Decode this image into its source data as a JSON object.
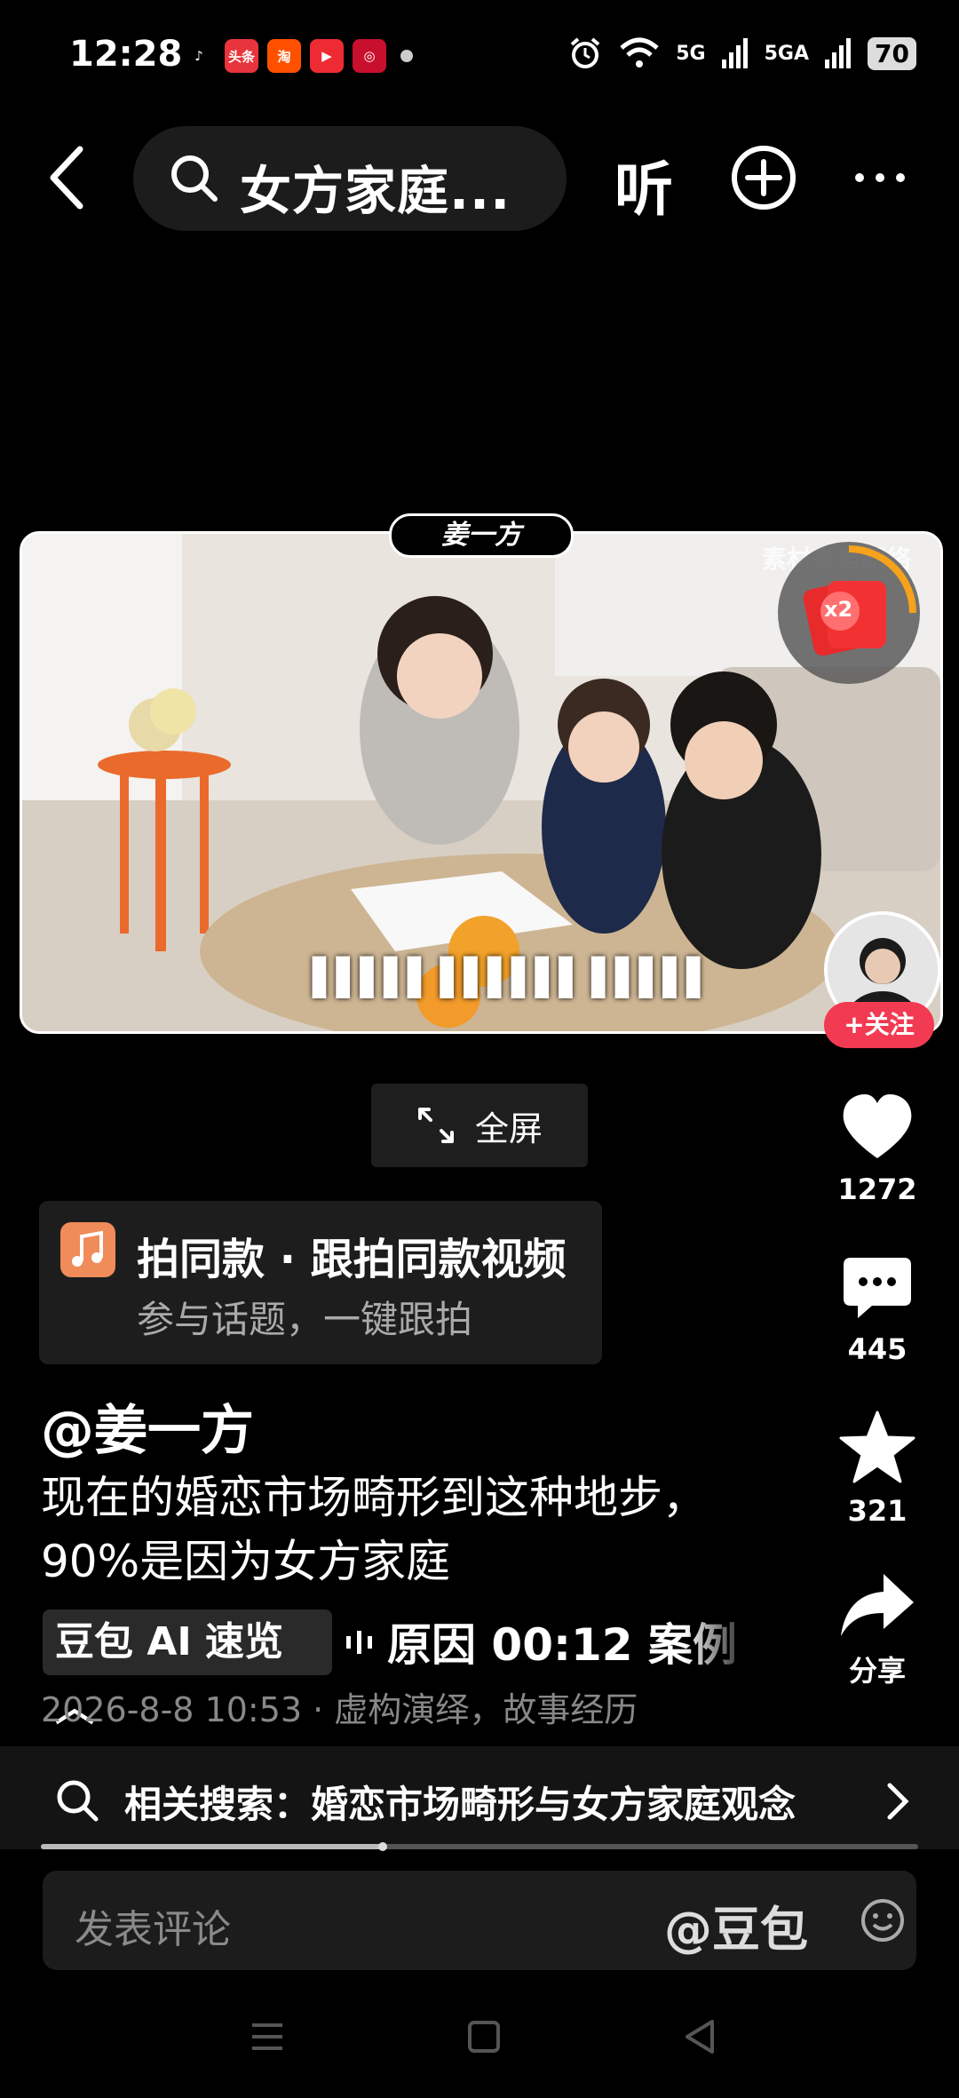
{
  "status_bar": {
    "time": "12:28",
    "apps": [
      {
        "icon": "tiktok-icon",
        "label": "",
        "color": "#000000"
      },
      {
        "icon": "toutiao-icon",
        "label": "头条",
        "color": "#e8343d"
      },
      {
        "icon": "taobao-icon",
        "label": "淘",
        "color": "#ff5000"
      },
      {
        "icon": "video-app-icon",
        "label": "",
        "color": "#ee2b32"
      },
      {
        "icon": "bank-icon",
        "label": "",
        "color": "#c8102e"
      }
    ],
    "network_1": "5G",
    "network_2": "5GA",
    "battery": "70"
  },
  "top_nav": {
    "search_query": "女方家庭...",
    "listen_label": "听"
  },
  "video": {
    "author_tag": "姜一方",
    "caption_blur": "▌▌▌▌▌ ▌▌▌▌▌▌ ▌▌▌▌▌",
    "watermark": "素材来自网络",
    "redpack_multiplier": "x2",
    "follow_label": "+关注"
  },
  "fullscreen_label": "全屏",
  "rail": {
    "likes": "1272",
    "comments": "445",
    "favorites": "321",
    "share": "分享"
  },
  "music_card": {
    "title": "拍同款 · 跟拍同款视频",
    "subtitle": "参与话题，一键跟拍"
  },
  "post": {
    "handle": "@姜一方",
    "description": "现在的婚恋市场畸形到这种地步，90%是因为女方家庭",
    "ai_button": "豆包 AI 速览",
    "chapter": "原因   00:12 案例",
    "meta": "2026-8-8 10:53 · 虚构演绎，故事经历"
  },
  "related_search": "相关搜索：婚恋市场畸形与女方家庭观念",
  "progress": 0.39,
  "comment": {
    "placeholder": "发表评论",
    "at_label": "@豆包"
  },
  "colors": {
    "accent_red": "#f23a52",
    "music_orange": "#f08b5a"
  }
}
